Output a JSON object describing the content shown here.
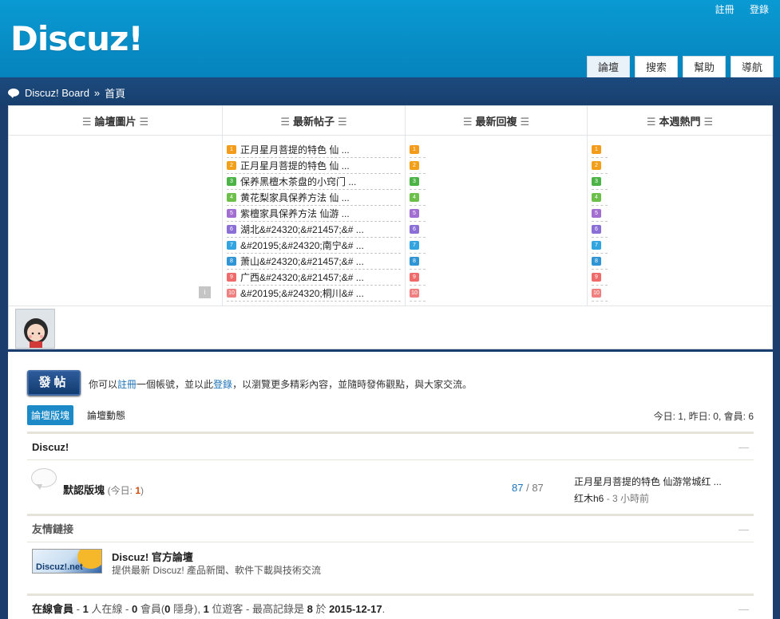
{
  "header": {
    "logo": "Discuz!",
    "top_links": [
      "註冊",
      "登錄"
    ],
    "nav_tabs": [
      "論壇",
      "搜索",
      "幫助",
      "導航"
    ]
  },
  "breadcrumb": {
    "site": "Discuz! Board",
    "sep": "»",
    "current": "首頁"
  },
  "stats_columns": {
    "pics": "論壇圖片",
    "new_posts": "最新帖子",
    "new_replies": "最新回複",
    "hot": "本週熱門"
  },
  "new_posts": [
    "正月星月菩提的特色 仙 ...",
    "正月星月菩提的特色 仙 ...",
    "保养黑檀木茶盘的小窍门 ...",
    "黄花梨家具保养方法 仙 ...",
    "紫檀家具保养方法 仙游 ...",
    "湖北&#24320;&#21457;&# ...",
    "&#20195;&#24320;南宁&# ...",
    "萧山&#24320;&#21457;&# ...",
    "广西&#24320;&#21457;&# ...",
    "&#20195;&#24320;桐川&# ..."
  ],
  "rank_numbers": [
    "1",
    "2",
    "3",
    "4",
    "5",
    "6",
    "7",
    "8",
    "9",
    "10"
  ],
  "intro": {
    "post_button": "發帖",
    "prefix": "你可以",
    "register": "註冊",
    "middle": "一個帳號，並以此",
    "login": "登錄",
    "suffix": "，以瀏覽更多精彩內容，並隨時發佈觀點，與大家交流。"
  },
  "tabs": [
    "論壇版塊",
    "論壇動態"
  ],
  "today_stats": "今日: 1, 昨日: 0, 會員: 6",
  "category": {
    "title": "Discuz!",
    "collapse": "—"
  },
  "forum": {
    "name": "默認版塊",
    "today_label": "(今日: ",
    "today_count": "1",
    "today_close": ")",
    "threads": "87",
    "slash": " / ",
    "posts": "87",
    "last_post_title": "正月星月菩提的特色 仙游常城红 ...",
    "last_post_author": "红木h6",
    "last_post_time": " - 3 小時前"
  },
  "links_section": {
    "title": "友情鏈接",
    "collapse": "—"
  },
  "friend_link": {
    "logo_text": "Discuz!.net",
    "title": "Discuz! 官方論壇",
    "desc": "提供最新 Discuz! 產品新聞、軟件下載與技術交流"
  },
  "online": {
    "label": "在線會員",
    "text1": " - ",
    "n_online": "1",
    "text2": " 人在線 - ",
    "n_members": "0",
    "text3": " 會員(",
    "n_hidden": "0",
    "text4": " 隱身), ",
    "n_guests": "1",
    "text5": " 位遊客 - 最高記錄是 ",
    "record": "8",
    "text6": " 於 ",
    "record_date": "2015-12-17",
    "text7": ".",
    "collapse": "—"
  }
}
